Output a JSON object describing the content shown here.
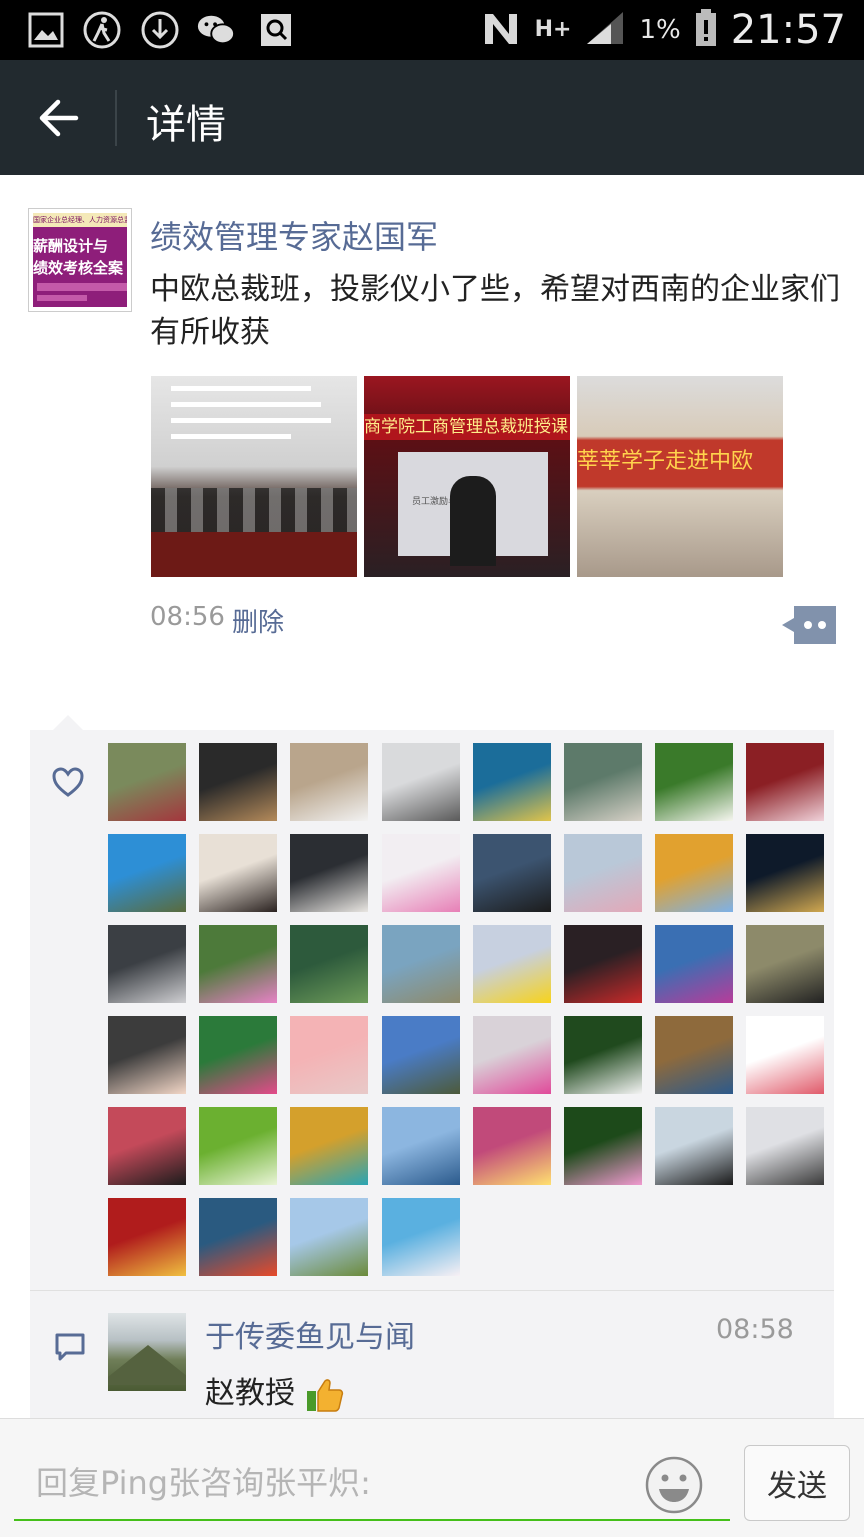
{
  "status_bar": {
    "signal_type": "H+",
    "battery": "1%",
    "time": "21:57",
    "left_icons": [
      "gallery-icon",
      "walker-icon",
      "download-icon",
      "wechat-icon",
      "search-notebook-icon"
    ]
  },
  "header": {
    "title": "详情"
  },
  "post": {
    "author": "绩效管理专家赵国军",
    "avatar_text": {
      "strip": "国家企业总经理、人力资源总监 (HRD)",
      "line1": "薪酬设计与",
      "line2": "绩效考核全案"
    },
    "text": "中欧总裁班，投影仪小了些，希望对西南的企业家们有所收获",
    "photos": [
      {
        "alt": "classroom"
      },
      {
        "alt": "lecture",
        "banner": "商学院工商管理总裁班授课",
        "screen_title": "员工激励与绩效管理"
      },
      {
        "alt": "banner",
        "banner": "莘莘学子走进中欧"
      }
    ],
    "time": "08:56",
    "delete_label": "删除"
  },
  "likes": {
    "avatars": [
      {
        "c1": "#7a8a5c",
        "c2": "#a4363d"
      },
      {
        "c1": "#2a2a2a",
        "c2": "#b48a5a"
      },
      {
        "c1": "#b9a58c",
        "c2": "#f2f2f2"
      },
      {
        "c1": "#d9dadc",
        "c2": "#5a5a5a"
      },
      {
        "c1": "#1b6d9a",
        "c2": "#e0c44b"
      },
      {
        "c1": "#5d7a6a",
        "c2": "#d8d2c8"
      },
      {
        "c1": "#3a7a2a",
        "c2": "#f6f6f0"
      },
      {
        "c1": "#8b1f24",
        "c2": "#f0d2da"
      },
      {
        "c1": "#2d8fd6",
        "c2": "#5a6b3c"
      },
      {
        "c1": "#e8e0d6",
        "c2": "#2a2220"
      },
      {
        "c1": "#2b2e33",
        "c2": "#e9e6e2"
      },
      {
        "c1": "#f2eef2",
        "c2": "#e77fb6"
      },
      {
        "c1": "#3c5470",
        "c2": "#1c1c1c"
      },
      {
        "c1": "#b9c8d8",
        "c2": "#e3a8b8"
      },
      {
        "c1": "#e1a12f",
        "c2": "#7db1e8"
      },
      {
        "c1": "#0e1a2a",
        "c2": "#d1a850"
      },
      {
        "c1": "#3b3f44",
        "c2": "#cfcfd2"
      },
      {
        "c1": "#4d7a3a",
        "c2": "#e782c6"
      },
      {
        "c1": "#2d5a3c",
        "c2": "#6e9c5a"
      },
      {
        "c1": "#7aa4c0",
        "c2": "#8e8a6a"
      },
      {
        "c1": "#c7d0e0",
        "c2": "#f7d31c"
      },
      {
        "c1": "#2a2024",
        "c2": "#c92a2a"
      },
      {
        "c1": "#3a6fb3",
        "c2": "#b83c9a"
      },
      {
        "c1": "#8d8a6a",
        "c2": "#222222"
      },
      {
        "c1": "#3c3c3c",
        "c2": "#f3d7c7"
      },
      {
        "c1": "#2b7a3a",
        "c2": "#e44a8a"
      },
      {
        "c1": "#f4b3b5",
        "c2": "#e8c9c8"
      },
      {
        "c1": "#4a7cc6",
        "c2": "#4d5a3a"
      },
      {
        "c1": "#d9d2d8",
        "c2": "#e04a9a"
      },
      {
        "c1": "#204a1e",
        "c2": "#f4f4f4"
      },
      {
        "c1": "#8e6a3c",
        "c2": "#2c5a8c"
      },
      {
        "c1": "#ffffff",
        "c2": "#e05a6a"
      },
      {
        "c1": "#c44a5a",
        "c2": "#1c1c1c"
      },
      {
        "c1": "#6bb030",
        "c2": "#e9f4d6"
      },
      {
        "c1": "#d4a02c",
        "c2": "#2aa4b4"
      },
      {
        "c1": "#8cb6e0",
        "c2": "#2b5a8c"
      },
      {
        "c1": "#c14a7a",
        "c2": "#ffe070"
      },
      {
        "c1": "#1d4a1a",
        "c2": "#f19ad0"
      },
      {
        "c1": "#c9d6e0",
        "c2": "#1a1a1a"
      },
      {
        "c1": "#dfe0e4",
        "c2": "#3a3a3a"
      },
      {
        "c1": "#b01c1c",
        "c2": "#f0c040"
      },
      {
        "c1": "#2a5a80",
        "c2": "#e84a2a"
      },
      {
        "c1": "#a6c8e8",
        "c2": "#6b8a3a"
      },
      {
        "c1": "#5ab0e0",
        "c2": "#f8f0f4"
      }
    ]
  },
  "comment": {
    "author": "于传委鱼见与闻",
    "time": "08:58",
    "text": "赵教授"
  },
  "reply": {
    "placeholder": "回复Ping张咨询张平炽:",
    "send_label": "发送"
  },
  "colors": {
    "link_blue": "#576b95",
    "header_bg": "#222a2f",
    "input_underline": "#45c01a"
  }
}
